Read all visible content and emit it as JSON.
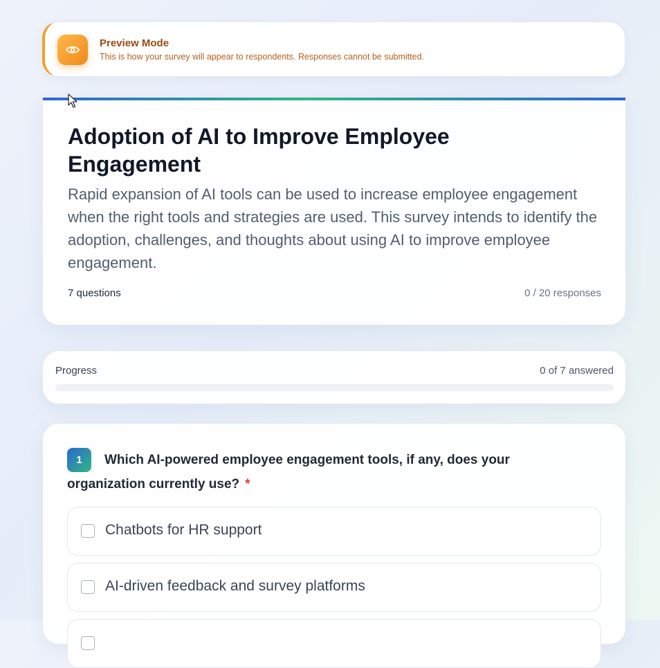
{
  "banner": {
    "title": "Preview Mode",
    "message": "This is how your survey will appear to respondents. Responses cannot be submitted.",
    "icon": "eye-icon",
    "accent_color": "#f59e2b"
  },
  "survey": {
    "title": "Adoption of AI to Improve Employee Engagement",
    "description": "Rapid expansion of AI tools can be used to increase employee engagement when the right tools and strategies are used. This survey intends to identify the adoption, challenges, and thoughts about using AI to improve employee engagement.",
    "question_count_label": "7 questions",
    "responses_label": "0 / 20 responses"
  },
  "progress": {
    "label": "Progress",
    "count_label": "0 of 7 answered",
    "fraction": 0
  },
  "question": {
    "number": "1",
    "text": "Which AI-powered employee engagement tools, if any, does your organization currently use?",
    "required_marker": "*",
    "options": [
      {
        "label": "Chatbots for HR support",
        "checked": false
      },
      {
        "label": "AI-driven feedback and survey platforms",
        "checked": false
      },
      {
        "label": "",
        "checked": false
      }
    ]
  },
  "colors": {
    "brand_blue": "#2c66d4",
    "brand_green": "#2fb880",
    "warning_orange": "#f59e2b",
    "required_red": "#e03b3b"
  }
}
